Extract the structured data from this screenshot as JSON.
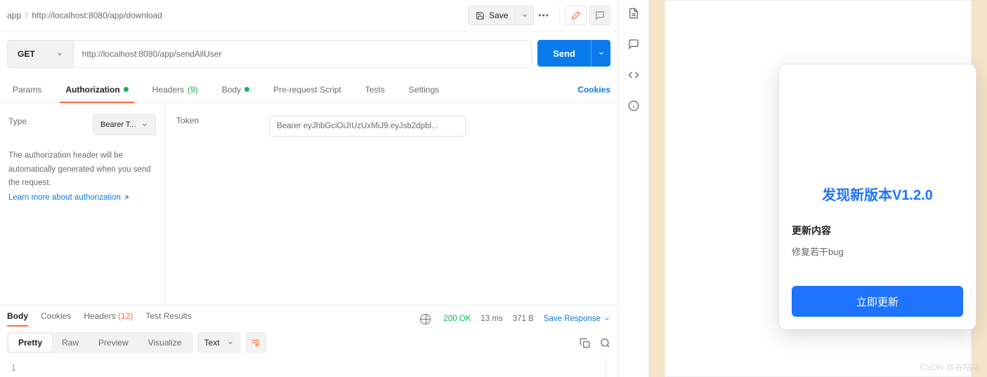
{
  "breadcrumb": {
    "folder": "app",
    "path": "http://localhost:8080/app/download"
  },
  "toolbar": {
    "save": "Save"
  },
  "request": {
    "method": "GET",
    "url": "http://localhost:8080/app/sendAllUser",
    "send": "Send"
  },
  "tabs": {
    "params": "Params",
    "auth": "Authorization",
    "headers": "Headers",
    "headers_count": "(9)",
    "body": "Body",
    "prerequest": "Pre-request Script",
    "tests": "Tests",
    "settings": "Settings",
    "cookies": "Cookies"
  },
  "auth": {
    "type_label": "Type",
    "type_value": "Bearer T...",
    "desc": "The authorization header will be automatically generated when you send the request.",
    "learn": "Learn more about authorization",
    "token_label": "Token",
    "token_value": "Bearer eyJhbGciOiJIUzUxMiJ9.eyJsb2dpbl..."
  },
  "response": {
    "tabs": {
      "body": "Body",
      "cookies": "Cookies",
      "headers": "Headers",
      "headers_count": "(12)",
      "tests": "Test Results"
    },
    "status": "200 OK",
    "time": "13 ms",
    "size": "371 B",
    "save": "Save Response",
    "view": {
      "pretty": "Pretty",
      "raw": "Raw",
      "preview": "Preview",
      "visualize": "Visualize"
    },
    "format": "Text",
    "body_line_num": "1"
  },
  "dialog": {
    "title": "发现新版本V1.2.0",
    "subtitle": "更新内容",
    "content": "修复若干bug",
    "button": "立即更新"
  },
  "watermark": "CSDN @谷咕咕"
}
